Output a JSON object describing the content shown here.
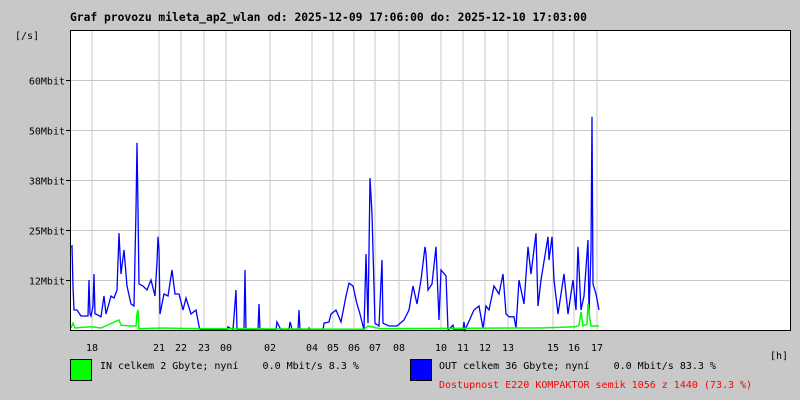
{
  "chart_data": {
    "type": "line",
    "title": "Graf provozu mileta_ap2_wlan od: 2025-12-09 17:06:00 do: 2025-12-10 17:03:00",
    "ylabel": "[/s]",
    "xlabel": "[h]",
    "ylim": [
      0,
      75
    ],
    "xlim": [
      0,
      720
    ],
    "y_unit": "Mbit/s",
    "grid": true,
    "yticks": [
      {
        "value": 12.5,
        "label": "12Mbit"
      },
      {
        "value": 25,
        "label": "25Mbit"
      },
      {
        "value": 37.5,
        "label": "38Mbit"
      },
      {
        "value": 50,
        "label": "50Mbit"
      },
      {
        "value": 62.5,
        "label": "60Mbit"
      }
    ],
    "xtick_labels": [
      "18",
      "21",
      "22",
      "23",
      "00",
      "02",
      "04",
      "05",
      "06",
      "07",
      "08",
      "10",
      "11",
      "12",
      "13",
      "15",
      "16",
      "17"
    ],
    "series": [
      {
        "name": "OUT",
        "color": "#0000ff",
        "points": [
          [
            0,
            20.8
          ],
          [
            1,
            21
          ],
          [
            2,
            10.8
          ],
          [
            3,
            5
          ],
          [
            6,
            5
          ],
          [
            10,
            3.5
          ],
          [
            17,
            3.5
          ],
          [
            18,
            12.5
          ],
          [
            19,
            4
          ],
          [
            20,
            3.5
          ],
          [
            22,
            6
          ],
          [
            23,
            14
          ],
          [
            24,
            4
          ],
          [
            25,
            4
          ],
          [
            30,
            3.3
          ],
          [
            33,
            8.5
          ],
          [
            35,
            4
          ],
          [
            40,
            8.5
          ],
          [
            43,
            8
          ],
          [
            46,
            10
          ],
          [
            48,
            24.2
          ],
          [
            50,
            14
          ],
          [
            53,
            20
          ],
          [
            56,
            11
          ],
          [
            60,
            6.5
          ],
          [
            63,
            6
          ],
          [
            65,
            30
          ],
          [
            66,
            46.8
          ],
          [
            67,
            30
          ],
          [
            68,
            11.5
          ],
          [
            72,
            11
          ],
          [
            76,
            10
          ],
          [
            80,
            12.5
          ],
          [
            84,
            8.5
          ],
          [
            86,
            17
          ],
          [
            87,
            23.3
          ],
          [
            88,
            20
          ],
          [
            89,
            4
          ],
          [
            93,
            9
          ],
          [
            97,
            8.5
          ],
          [
            101,
            15
          ],
          [
            104,
            9
          ],
          [
            108,
            9
          ],
          [
            112,
            5
          ],
          [
            115,
            8
          ],
          [
            120,
            4
          ],
          [
            125,
            5
          ],
          [
            128,
            1
          ],
          [
            129,
            0
          ],
          [
            156,
            0
          ],
          [
            157,
            0.8
          ],
          [
            162,
            0
          ],
          [
            165,
            10
          ],
          [
            166,
            0
          ],
          [
            173,
            0
          ],
          [
            174,
            15
          ],
          [
            175,
            0
          ],
          [
            187,
            0
          ],
          [
            188,
            6.5
          ],
          [
            189,
            0
          ],
          [
            205,
            0
          ],
          [
            206,
            2
          ],
          [
            208,
            1
          ],
          [
            210,
            0
          ],
          [
            218,
            0
          ],
          [
            219,
            2
          ],
          [
            220,
            1.2
          ],
          [
            221,
            0
          ],
          [
            227,
            0
          ],
          [
            228,
            5
          ],
          [
            229,
            0
          ],
          [
            237,
            0
          ],
          [
            238,
            0.5
          ],
          [
            239,
            0
          ],
          [
            252,
            0
          ],
          [
            253,
            1.7
          ],
          [
            258,
            2
          ],
          [
            260,
            4
          ],
          [
            265,
            5
          ],
          [
            270,
            2
          ],
          [
            275,
            8.5
          ],
          [
            278,
            11.7
          ],
          [
            282,
            11
          ],
          [
            286,
            6.5
          ],
          [
            289,
            4
          ],
          [
            293,
            0
          ],
          [
            295,
            19
          ],
          [
            297,
            1.7
          ],
          [
            299,
            38
          ],
          [
            301,
            29
          ],
          [
            304,
            1.7
          ],
          [
            308,
            1
          ],
          [
            311,
            17.5
          ],
          [
            312,
            1.7
          ],
          [
            318,
            1
          ],
          [
            326,
            1
          ],
          [
            333,
            2.5
          ],
          [
            338,
            5
          ],
          [
            342,
            11
          ],
          [
            346,
            6.5
          ],
          [
            350,
            12.5
          ],
          [
            354,
            20.8
          ],
          [
            355,
            19
          ],
          [
            357,
            10
          ],
          [
            361,
            11.5
          ],
          [
            365,
            20.8
          ],
          [
            368,
            2.5
          ],
          [
            370,
            15
          ],
          [
            375,
            13.5
          ],
          [
            377,
            0
          ],
          [
            382,
            1.2
          ],
          [
            383,
            0
          ],
          [
            392,
            0
          ],
          [
            393,
            2
          ],
          [
            394,
            0
          ],
          [
            403,
            5
          ],
          [
            408,
            6
          ],
          [
            412,
            0.4
          ],
          [
            415,
            6
          ],
          [
            418,
            5
          ],
          [
            423,
            11
          ],
          [
            428,
            9
          ],
          [
            432,
            14
          ],
          [
            435,
            4
          ],
          [
            438,
            3.3
          ],
          [
            443,
            3.3
          ],
          [
            445,
            0.5
          ],
          [
            448,
            12.5
          ],
          [
            453,
            6.5
          ],
          [
            457,
            20.8
          ],
          [
            460,
            14
          ],
          [
            465,
            24.2
          ],
          [
            467,
            6
          ],
          [
            470,
            12.5
          ],
          [
            477,
            23.3
          ],
          [
            478,
            17.5
          ],
          [
            481,
            23.3
          ],
          [
            483,
            12.5
          ],
          [
            487,
            4
          ],
          [
            493,
            14
          ],
          [
            497,
            4
          ],
          [
            502,
            12.5
          ],
          [
            505,
            5
          ],
          [
            507,
            20.8
          ],
          [
            510,
            5
          ],
          [
            513,
            8.5
          ],
          [
            517,
            22.5
          ],
          [
            518,
            4
          ],
          [
            520,
            20
          ],
          [
            521,
            53.3
          ],
          [
            522,
            11.5
          ],
          [
            525,
            9
          ],
          [
            528,
            5
          ]
        ]
      },
      {
        "name": "IN",
        "color": "#00ff00",
        "points": [
          [
            0,
            0.5
          ],
          [
            2,
            1.7
          ],
          [
            4,
            0.5
          ],
          [
            20,
            0.8
          ],
          [
            30,
            0.5
          ],
          [
            48,
            2.5
          ],
          [
            50,
            1.2
          ],
          [
            60,
            1
          ],
          [
            65,
            1
          ],
          [
            66,
            4
          ],
          [
            67,
            5
          ],
          [
            68,
            0.3
          ],
          [
            90,
            0.5
          ],
          [
            128,
            0.3
          ],
          [
            293,
            0.2
          ],
          [
            297,
            1
          ],
          [
            310,
            0.3
          ],
          [
            440,
            0.5
          ],
          [
            470,
            0.5
          ],
          [
            505,
            0.8
          ],
          [
            508,
            1.2
          ],
          [
            510,
            4.5
          ],
          [
            512,
            1
          ],
          [
            516,
            1.5
          ],
          [
            517,
            6.5
          ],
          [
            519,
            2.5
          ],
          [
            520,
            1
          ],
          [
            528,
            1
          ]
        ]
      }
    ]
  },
  "legend": {
    "in_text": "IN celkem 2 Gbyte; nyní    0.0 Mbit/s 8.3 %",
    "out_text": "OUT celkem 36 Gbyte; nyní    0.0 Mbit/s 83.3 %",
    "availability": "Dostupnost E220 KOMPAKTOR semik 1056 z 1440 (73.3 %)",
    "availability_color": "#ff0000",
    "in_color": "#00ff00",
    "out_color": "#0000ff"
  }
}
